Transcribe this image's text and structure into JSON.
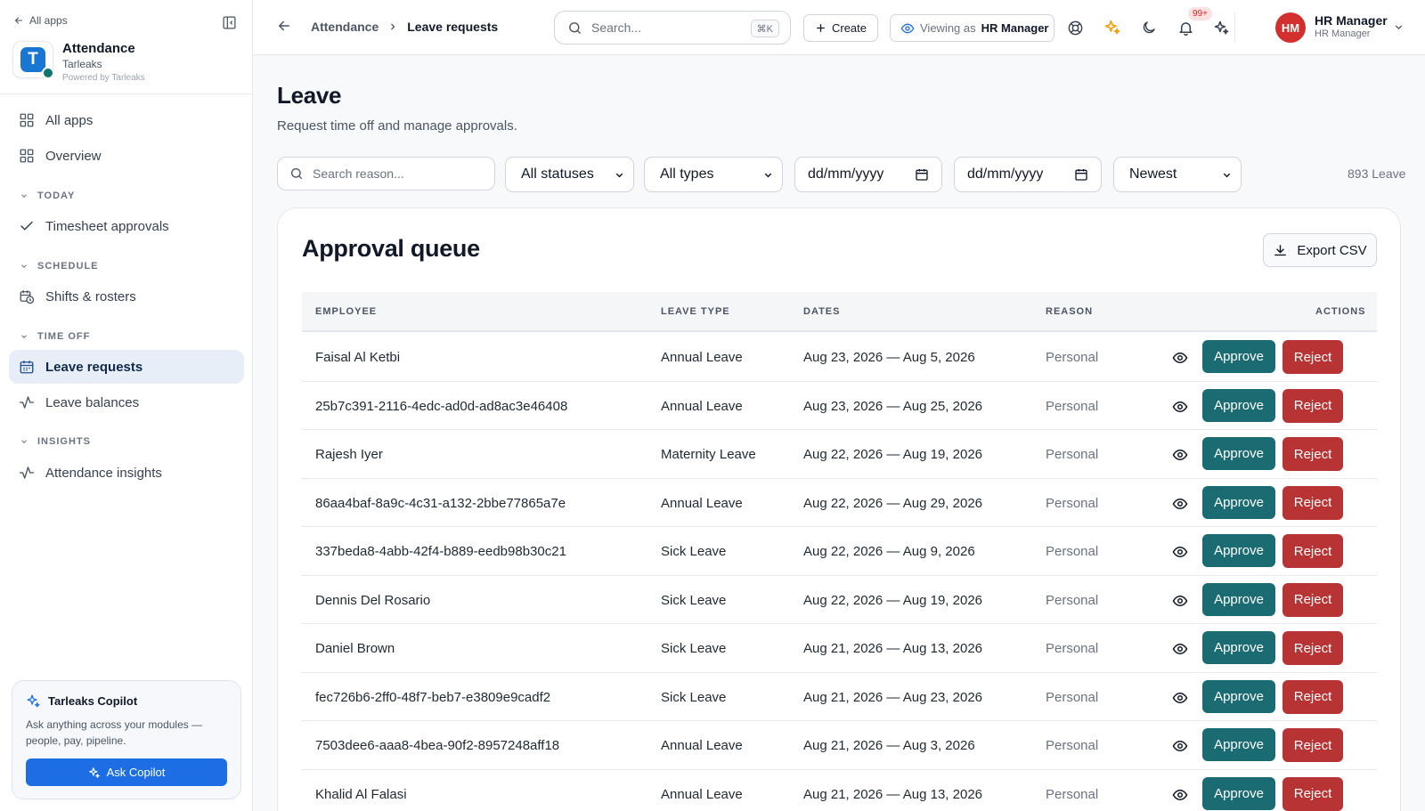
{
  "sidebar": {
    "all_apps_link": "All apps",
    "brand": {
      "name": "Attendance",
      "org": "Tarleaks",
      "powered_by": "Powered by Tarleaks",
      "logo_letter": "T"
    },
    "items": [
      {
        "label": "All apps",
        "icon": "grid-icon"
      },
      {
        "label": "Overview",
        "icon": "grid-icon"
      }
    ],
    "sections": [
      {
        "title": "TODAY",
        "items": [
          {
            "label": "Timesheet approvals",
            "icon": "check-icon"
          }
        ]
      },
      {
        "title": "SCHEDULE",
        "items": [
          {
            "label": "Shifts & rosters",
            "icon": "calendar-clock-icon"
          }
        ]
      },
      {
        "title": "TIME OFF",
        "items": [
          {
            "label": "Leave requests",
            "icon": "calendar-icon",
            "active": true
          },
          {
            "label": "Leave balances",
            "icon": "activity-icon"
          }
        ]
      },
      {
        "title": "INSIGHTS",
        "items": [
          {
            "label": "Attendance insights",
            "icon": "activity-icon"
          }
        ]
      }
    ],
    "copilot": {
      "title": "Tarleaks Copilot",
      "description": "Ask anything across your modules — people, pay, pipeline.",
      "button_label": "Ask Copilot"
    }
  },
  "header": {
    "breadcrumbs": [
      "Attendance",
      "Leave requests"
    ],
    "search": {
      "placeholder": "Search...",
      "shortcut": "⌘K"
    },
    "create_label": "Create",
    "viewing_as": {
      "prefix": "Viewing as",
      "role": "HR Manager"
    },
    "notifications_badge": "99+",
    "user": {
      "initials": "HM",
      "name": "HR Manager",
      "role": "HR Manager"
    }
  },
  "main": {
    "title": "Leave",
    "subtitle": "Request time off and manage approvals.",
    "filters": {
      "search_placeholder": "Search reason...",
      "status": "All statuses",
      "type": "All types",
      "date_from": "dd/mm/yyyy",
      "date_to": "dd/mm/yyyy",
      "sort": "Newest",
      "count": "893 Leave"
    },
    "card": {
      "title": "Approval queue",
      "export_label": "Export CSV",
      "columns": [
        "EMPLOYEE",
        "LEAVE TYPE",
        "DATES",
        "REASON",
        "ACTIONS"
      ],
      "approve_label": "Approve",
      "reject_label": "Reject",
      "rows": [
        {
          "employee": "Faisal Al Ketbi",
          "type": "Annual Leave",
          "dates": "Aug 23, 2026 — Aug 5, 2026",
          "reason": "Personal"
        },
        {
          "employee": "25b7c391-2116-4edc-ad0d-ad8ac3e46408",
          "type": "Annual Leave",
          "dates": "Aug 23, 2026 — Aug 25, 2026",
          "reason": "Personal"
        },
        {
          "employee": "Rajesh Iyer",
          "type": "Maternity Leave",
          "dates": "Aug 22, 2026 — Aug 19, 2026",
          "reason": "Personal"
        },
        {
          "employee": "86aa4baf-8a9c-4c31-a132-2bbe77865a7e",
          "type": "Annual Leave",
          "dates": "Aug 22, 2026 — Aug 29, 2026",
          "reason": "Personal"
        },
        {
          "employee": "337beda8-4abb-42f4-b889-eedb98b30c21",
          "type": "Sick Leave",
          "dates": "Aug 22, 2026 — Aug 9, 2026",
          "reason": "Personal"
        },
        {
          "employee": "Dennis Del Rosario",
          "type": "Sick Leave",
          "dates": "Aug 22, 2026 — Aug 19, 2026",
          "reason": "Personal"
        },
        {
          "employee": "Daniel Brown",
          "type": "Sick Leave",
          "dates": "Aug 21, 2026 — Aug 13, 2026",
          "reason": "Personal"
        },
        {
          "employee": "fec726b6-2ff0-48f7-beb7-e3809e9cadf2",
          "type": "Sick Leave",
          "dates": "Aug 21, 2026 — Aug 23, 2026",
          "reason": "Personal"
        },
        {
          "employee": "7503dee6-aaa8-4bea-90f2-8957248aff18",
          "type": "Annual Leave",
          "dates": "Aug 21, 2026 — Aug 3, 2026",
          "reason": "Personal"
        },
        {
          "employee": "Khalid Al Falasi",
          "type": "Annual Leave",
          "dates": "Aug 21, 2026 — Aug 13, 2026",
          "reason": "Personal"
        }
      ]
    }
  },
  "colors": {
    "accent": "#1d6de5",
    "approve": "#1a6b72",
    "reject": "#b83333",
    "active_nav_bg": "#e8eef7",
    "avatar_bg": "#d32f2f",
    "sparkle": "#f59e0b"
  }
}
